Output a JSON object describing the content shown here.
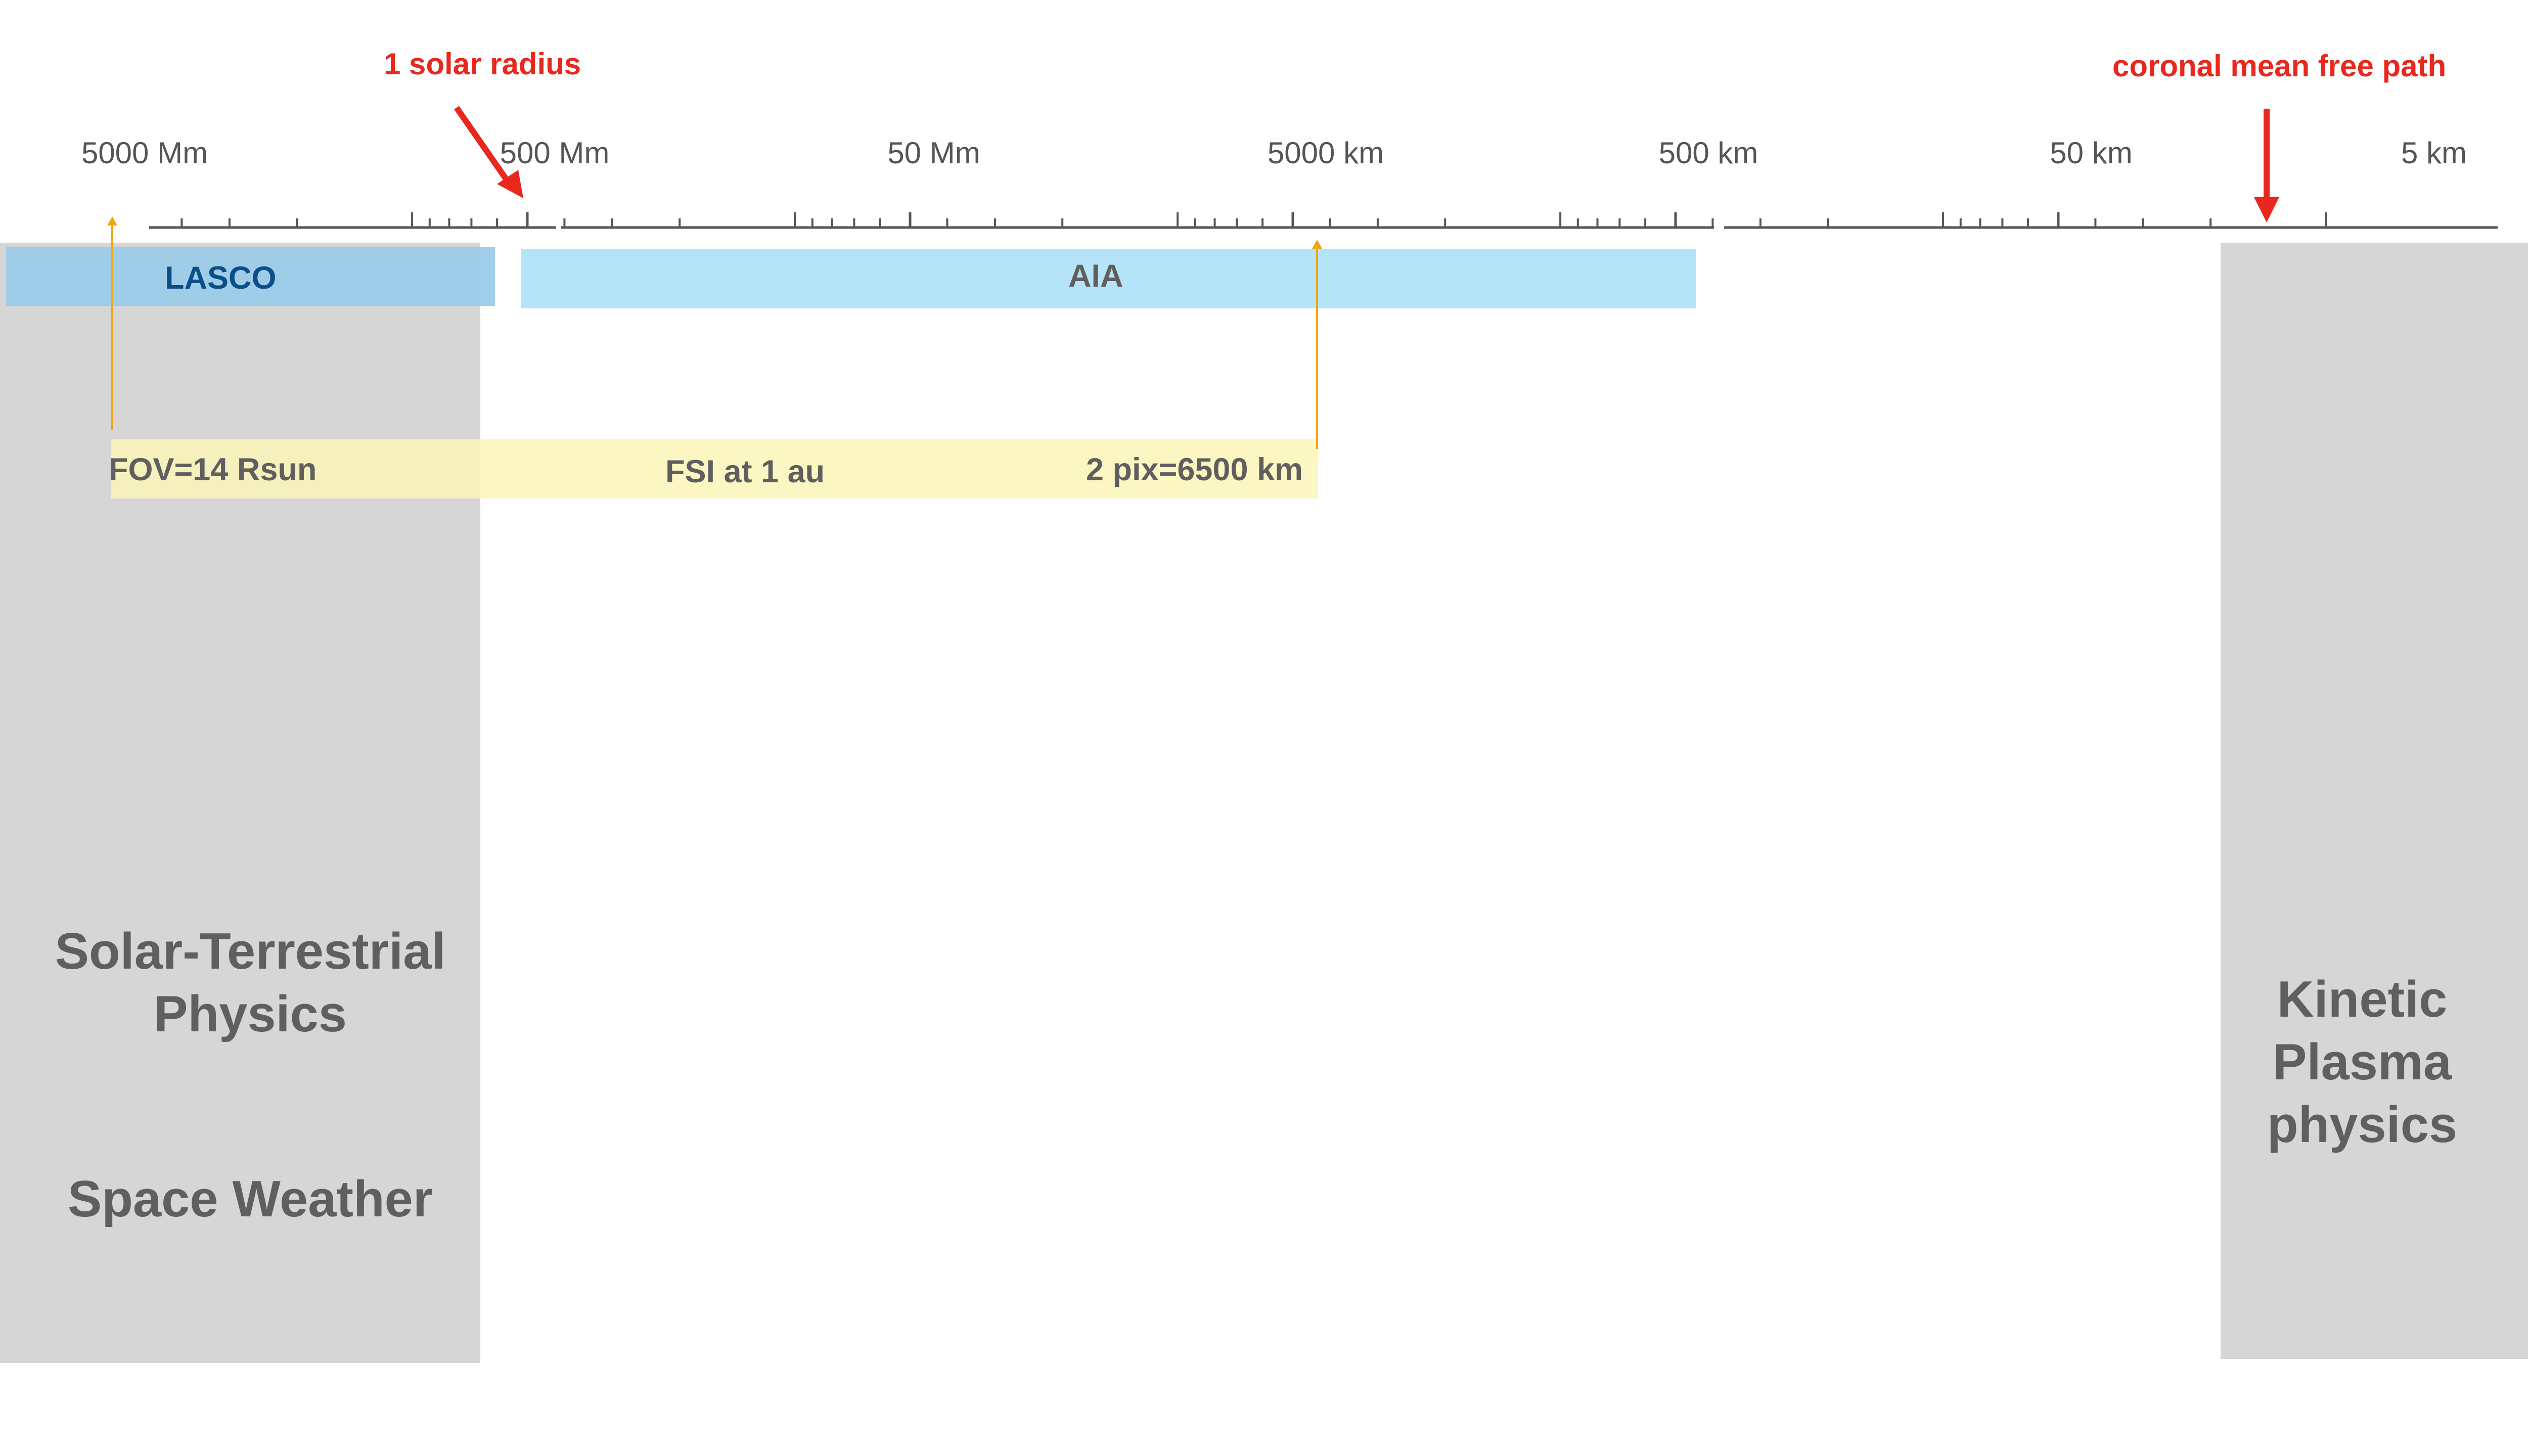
{
  "colors": {
    "axis": "#555555",
    "region": "#d6d6d6",
    "region_text": "#5f5f5f",
    "lasco": "#9ccbe8",
    "lasco_text": "#0b4f8a",
    "aia": "#b5e3f7",
    "fsi": "#fcf5b7",
    "fov_arrow": "#f0a60f",
    "annotation": "#e8281e"
  },
  "axis": {
    "scale": "log",
    "direction": "decreasing",
    "unit_base": "km",
    "range_km": [
      10000000,
      3
    ],
    "tick_labels": [
      {
        "label": "5000 Mm",
        "value_km": 5000000
      },
      {
        "label": "500 Mm",
        "value_km": 500000
      },
      {
        "label": "50 Mm",
        "value_km": 50000
      },
      {
        "label": "5000 km",
        "value_km": 5000
      },
      {
        "label": "500 km",
        "value_km": 500
      },
      {
        "label": "50 km",
        "value_km": 50
      },
      {
        "label": "5 km",
        "value_km": 5
      }
    ]
  },
  "annotations": {
    "solar_radius": {
      "label": "1 solar radius",
      "value_km": 700000
    },
    "mean_free_path": {
      "label": "coronal mean free path",
      "value_km": 15
    }
  },
  "instruments": {
    "lasco": {
      "label": "LASCO"
    },
    "aia": {
      "label": "AIA"
    },
    "fsi": {
      "label": "FSI at 1 au",
      "fov_label": "FOV=14 Rsun",
      "res_label": "2 pix=6500 km"
    }
  },
  "regions": {
    "solar_terrestrial": {
      "line1": "Solar-Terrestrial",
      "line2": "Physics"
    },
    "space_weather": {
      "label": "Space Weather"
    },
    "kinetic": {
      "line1": "Kinetic",
      "line2": "Plasma",
      "line3": "physics"
    }
  }
}
